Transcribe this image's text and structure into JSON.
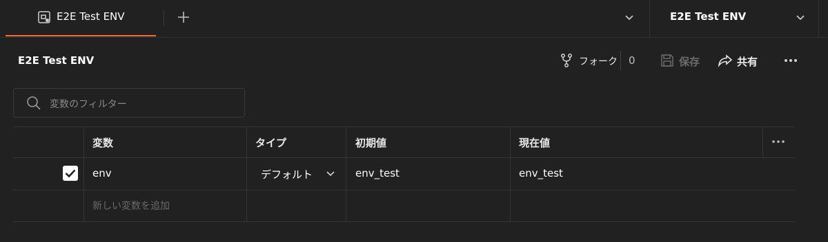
{
  "tabs": [
    {
      "label": "E2E Test ENV",
      "icon": "environment-icon",
      "active": true
    }
  ],
  "env_selector": {
    "label": "E2E Test ENV"
  },
  "header": {
    "title": "E2E Test ENV",
    "fork_label": "フォーク",
    "fork_count": "0",
    "save_label": "保存",
    "share_label": "共有"
  },
  "search": {
    "placeholder": "変数のフィルター"
  },
  "table": {
    "columns": [
      "変数",
      "タイプ",
      "初期値",
      "現在値"
    ],
    "rows": [
      {
        "checked": true,
        "variable": "env",
        "type": "デフォルト",
        "initial": "env_test",
        "current": "env_test"
      }
    ],
    "add_placeholder": "新しい変数を追加"
  },
  "colors": {
    "accent": "#ff6c37",
    "background": "#212121",
    "border": "#363636"
  }
}
